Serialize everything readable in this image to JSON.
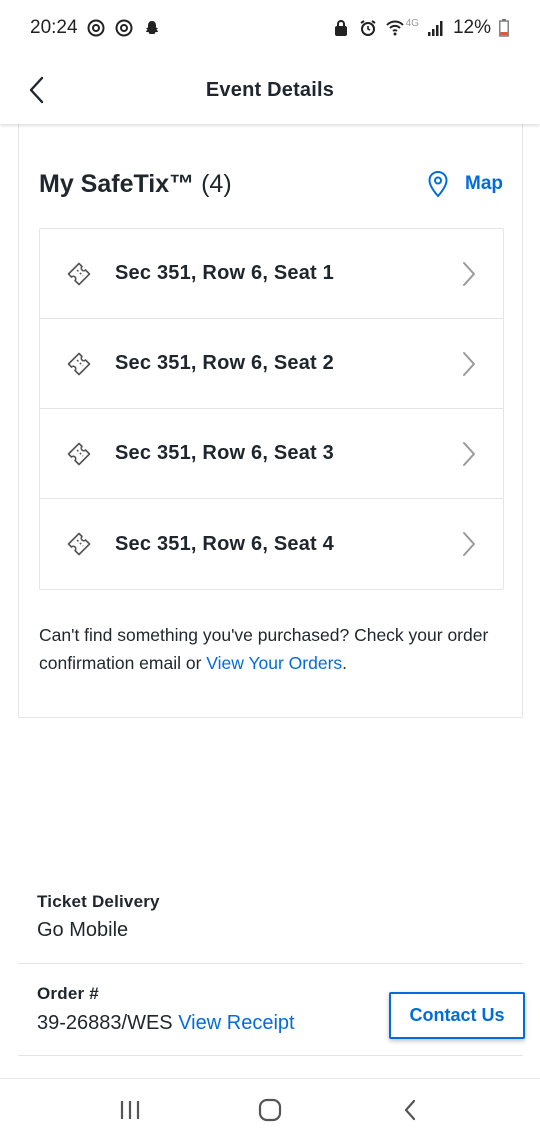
{
  "status_bar": {
    "time": "20:24",
    "battery_percent": "12%",
    "network_label": "4G"
  },
  "header": {
    "title": "Event Details"
  },
  "safetix": {
    "title_bold": "My SafeTix™",
    "count": "(4)",
    "map_label": "Map",
    "tickets": [
      {
        "label": "Sec 351, Row 6, Seat 1"
      },
      {
        "label": "Sec 351, Row 6, Seat 2"
      },
      {
        "label": "Sec 351, Row 6, Seat 3"
      },
      {
        "label": "Sec 351, Row 6, Seat 4"
      }
    ],
    "help_text": "Can't find something you've purchased? Check your order confirmation email or",
    "help_link": "View Your Orders",
    "help_end": "."
  },
  "details": {
    "delivery_label": "Ticket Delivery",
    "delivery_value": "Go Mobile",
    "order_label": "Order #",
    "order_value": "39-26883/WES",
    "receipt_link": "View Receipt"
  },
  "contact_button": "Contact Us",
  "colors": {
    "accent": "#026cdf",
    "text": "#1f262d",
    "border": "#e3e5e8"
  }
}
